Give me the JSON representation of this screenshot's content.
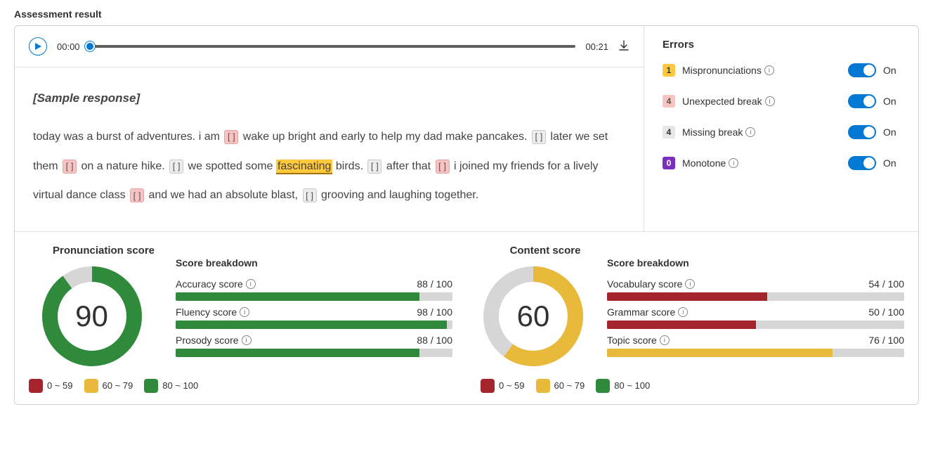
{
  "title": "Assessment result",
  "player": {
    "current": "00:00",
    "duration": "00:21"
  },
  "transcript": {
    "sample_label": "[Sample response]",
    "segments": [
      {
        "t": "text",
        "v": "today was a burst of adventures. i am "
      },
      {
        "t": "unexp"
      },
      {
        "t": "text",
        "v": " wake up bright and early to help my dad make pancakes. "
      },
      {
        "t": "miss"
      },
      {
        "t": "text",
        "v": " later we set them "
      },
      {
        "t": "unexp"
      },
      {
        "t": "text",
        "v": " on a nature hike. "
      },
      {
        "t": "miss"
      },
      {
        "t": "text",
        "v": " we spotted some "
      },
      {
        "t": "hl",
        "v": "fascinating"
      },
      {
        "t": "text",
        "v": " birds. "
      },
      {
        "t": "miss"
      },
      {
        "t": "text",
        "v": " after that "
      },
      {
        "t": "unexp"
      },
      {
        "t": "text",
        "v": " i joined my friends for a lively virtual dance class "
      },
      {
        "t": "unexp"
      },
      {
        "t": "text",
        "v": " and we had an absolute blast, "
      },
      {
        "t": "miss"
      },
      {
        "t": "text",
        "v": " grooving and laughing together."
      }
    ]
  },
  "errors": {
    "title": "Errors",
    "on_label": "On",
    "items": [
      {
        "count": "1",
        "cls": "c-mis",
        "label": "Mispronunciations"
      },
      {
        "count": "4",
        "cls": "c-unexp",
        "label": "Unexpected break"
      },
      {
        "count": "4",
        "cls": "c-missb",
        "label": "Missing break"
      },
      {
        "count": "0",
        "cls": "c-mono",
        "label": "Monotone"
      }
    ]
  },
  "legend": {
    "low": "0 ~ 59",
    "mid": "60 ~ 79",
    "high": "80 ~ 100"
  },
  "breakdown_label": "Score breakdown",
  "pronunciation": {
    "title": "Pronunciation score",
    "value": "90",
    "pct": 90,
    "color": "#2f8a3b",
    "metrics": [
      {
        "name": "Accuracy score",
        "value": "88 / 100",
        "pct": 88,
        "cls": "fill-green"
      },
      {
        "name": "Fluency score",
        "value": "98 / 100",
        "pct": 98,
        "cls": "fill-green"
      },
      {
        "name": "Prosody score",
        "value": "88 / 100",
        "pct": 88,
        "cls": "fill-green"
      }
    ]
  },
  "content": {
    "title": "Content score",
    "value": "60",
    "pct": 60,
    "color": "#e8b93a",
    "metrics": [
      {
        "name": "Vocabulary score",
        "value": "54 / 100",
        "pct": 54,
        "cls": "fill-red"
      },
      {
        "name": "Grammar score",
        "value": "50 / 100",
        "pct": 50,
        "cls": "fill-red"
      },
      {
        "name": "Topic score",
        "value": "76 / 100",
        "pct": 76,
        "cls": "fill-yellow"
      }
    ]
  },
  "chart_data": [
    {
      "type": "pie",
      "title": "Pronunciation score",
      "values": [
        90,
        10
      ],
      "categories": [
        "score",
        "remaining"
      ],
      "colors": [
        "#2f8a3b",
        "#d6d6d6"
      ]
    },
    {
      "type": "pie",
      "title": "Content score",
      "values": [
        60,
        40
      ],
      "categories": [
        "score",
        "remaining"
      ],
      "colors": [
        "#e8b93a",
        "#d6d6d6"
      ]
    },
    {
      "type": "bar",
      "title": "Pronunciation breakdown",
      "categories": [
        "Accuracy score",
        "Fluency score",
        "Prosody score"
      ],
      "values": [
        88,
        98,
        88
      ],
      "ylim": [
        0,
        100
      ]
    },
    {
      "type": "bar",
      "title": "Content breakdown",
      "categories": [
        "Vocabulary score",
        "Grammar score",
        "Topic score"
      ],
      "values": [
        54,
        50,
        76
      ],
      "ylim": [
        0,
        100
      ]
    }
  ]
}
